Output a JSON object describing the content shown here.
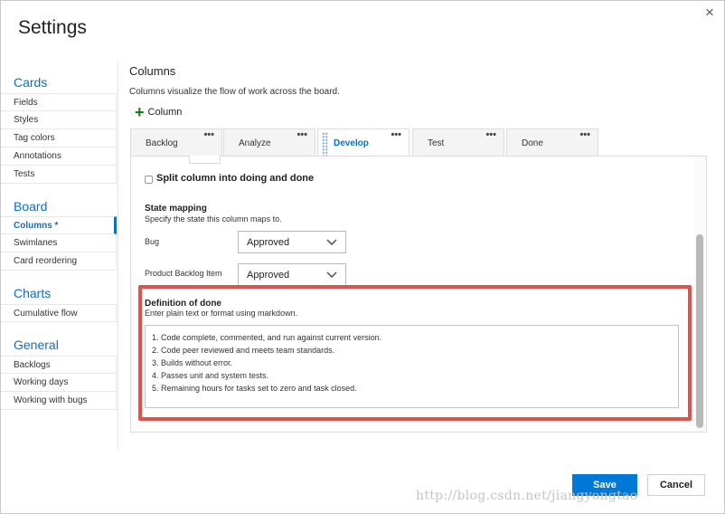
{
  "window": {
    "title": "Settings"
  },
  "sidebar": {
    "sections": [
      {
        "heading": "Cards",
        "items": [
          "Fields",
          "Styles",
          "Tag colors",
          "Annotations",
          "Tests"
        ]
      },
      {
        "heading": "Board",
        "items": [
          "Columns *",
          "Swimlanes",
          "Card reordering"
        ]
      },
      {
        "heading": "Charts",
        "items": [
          "Cumulative flow"
        ]
      },
      {
        "heading": "General",
        "items": [
          "Backlogs",
          "Working days",
          "Working with bugs"
        ]
      }
    ],
    "active_item": "Columns *"
  },
  "main": {
    "title": "Columns",
    "description": "Columns visualize the flow of work across the board.",
    "add_column_label": "Column",
    "tabs": [
      {
        "label": "Backlog",
        "menu": "•••"
      },
      {
        "label": "Analyze",
        "menu": "•••"
      },
      {
        "label": "Develop",
        "menu": "•••"
      },
      {
        "label": "Test",
        "menu": "•••"
      },
      {
        "label": "Done",
        "menu": "•••"
      }
    ],
    "active_tab": "Develop",
    "split_column_label": "Split column into doing and done",
    "state_mapping": {
      "title": "State mapping",
      "description": "Specify the state this column maps to.",
      "rows": [
        {
          "label": "Bug",
          "value": "Approved"
        },
        {
          "label": "Product Backlog Item",
          "value": "Approved"
        }
      ]
    },
    "definition_of_done": {
      "title": "Definition of done",
      "description": "Enter plain text or format using markdown.",
      "lines": [
        "1. Code complete, commented, and run against current version.",
        "2. Code peer reviewed and meets team standards.",
        "3. Builds without error.",
        "4. Passes unit and system tests.",
        "5. Remaining hours for tasks set to zero and task closed."
      ]
    }
  },
  "footer": {
    "save_label": "Save",
    "cancel_label": "Cancel"
  },
  "watermark": "http://blog.csdn.net/jiangyongtao",
  "colors": {
    "accent": "#0078d7",
    "link": "#106ebe",
    "highlight_border": "#e0534b",
    "add_icon": "#107c10"
  },
  "icons": {
    "close": "close-icon",
    "add": "plus-icon",
    "dropdown": "chevron-down-icon",
    "tab_menu": "more-icon",
    "drag": "drag-handle-icon"
  }
}
